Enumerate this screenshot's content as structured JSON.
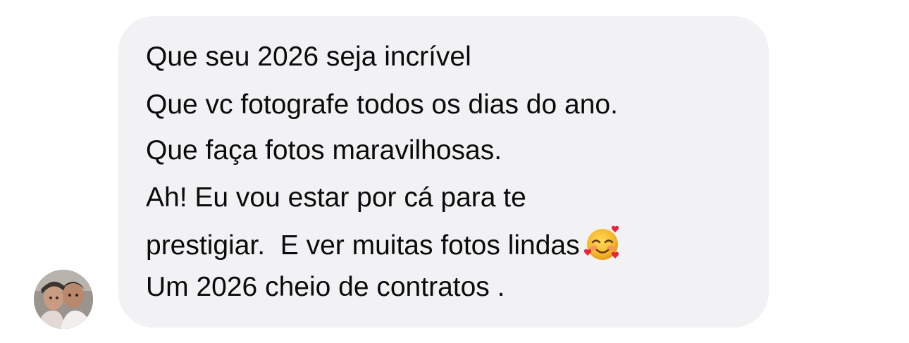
{
  "avatar": {
    "icon": "profile-photo-avatar"
  },
  "message": {
    "lines": [
      "Que seu 2026 seja incrível",
      "Que vc fotografe todos os dias do ano.",
      "Que faça fotos maravilhosas.",
      "Ah! Eu vou estar por cá para te",
      "prestigiar.  E ver muitas fotos lindas",
      "Um 2026 cheio de contratos ."
    ],
    "emoji": "smiling-face-with-hearts-icon",
    "bubble_color": "#f2f2f5",
    "text_color": "#0b0b0b"
  }
}
